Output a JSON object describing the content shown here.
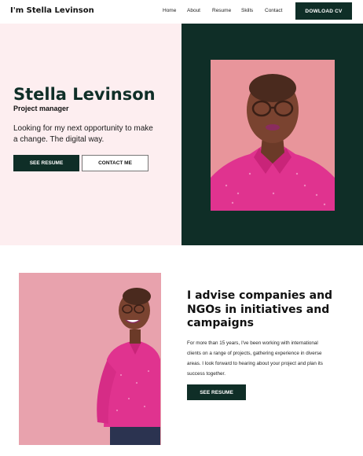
{
  "nav": {
    "brand": "I'm Stella Levinson",
    "links": [
      "Home",
      "About",
      "Resume",
      "Skills",
      "Contact"
    ],
    "cta": "DOWLOAD CV"
  },
  "hero": {
    "name": "Stella Levinson",
    "role": "Project manager",
    "tagline": "Looking for my next opportunity to make a change. The digital way.",
    "primary_button": "SEE RESUME",
    "secondary_button": "CONTACT ME"
  },
  "about": {
    "title": "I advise companies and NGOs in initiatives and campaigns",
    "body": "For more than 15 years, I've been working with international clients on a range of projects, gathering experience in diverse areas. I look forward to hearing about your project and plan its success together.",
    "button": "SEE RESUME"
  },
  "colors": {
    "accent_dark": "#0f2e27",
    "hero_bg": "#fdeef0",
    "photo_pink": "#e8959b",
    "shirt_magenta": "#e0338f"
  }
}
